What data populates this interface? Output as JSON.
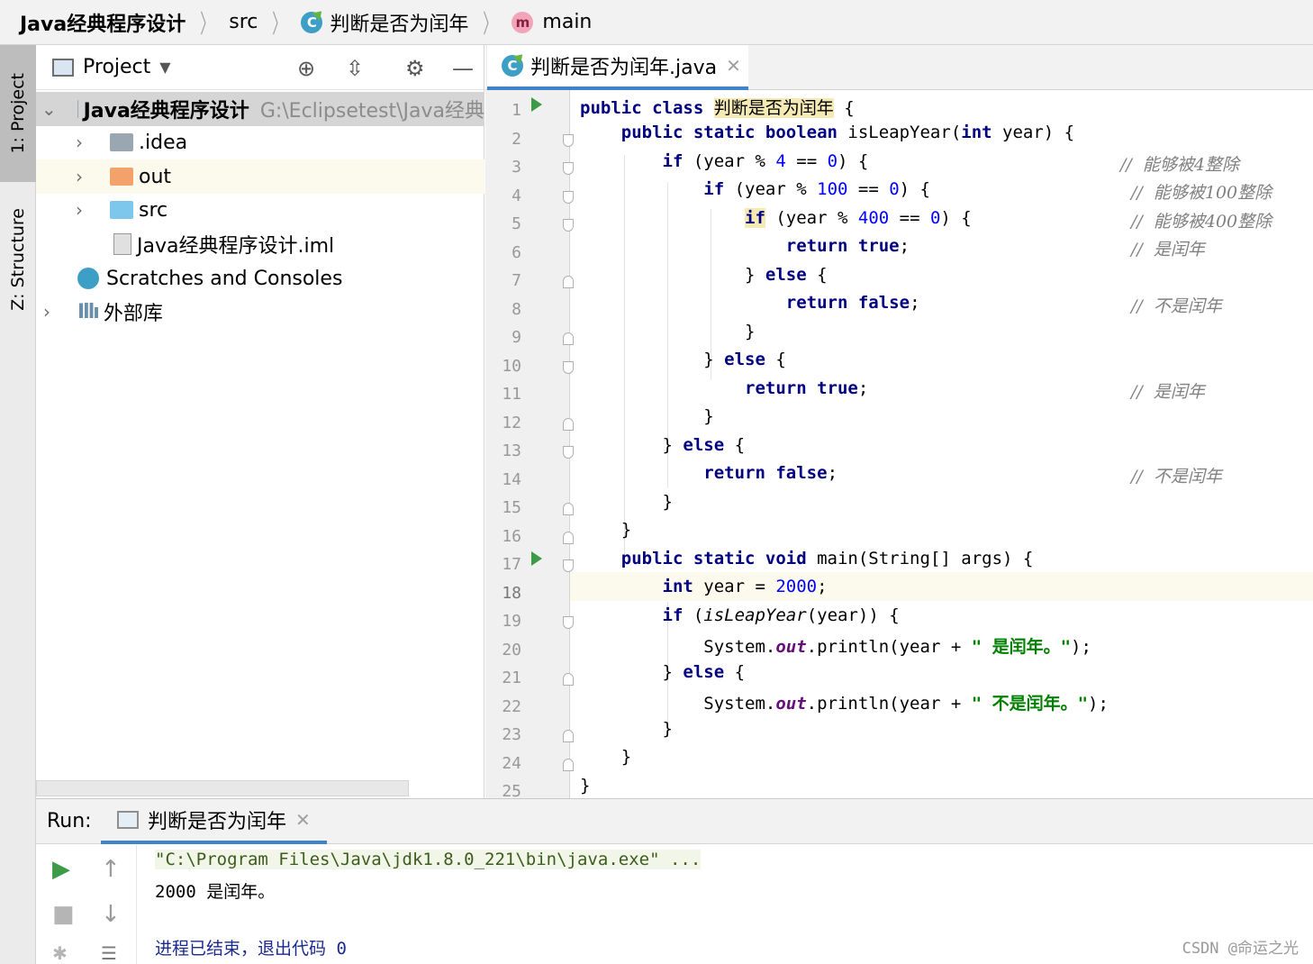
{
  "breadcrumb": {
    "project": "Java经典程序设计",
    "folder": "src",
    "class_icon": "C",
    "class_name": "判断是否为闰年",
    "method_icon": "m",
    "method_name": "main"
  },
  "tool_windows": {
    "project_tab": "1: Project",
    "structure_tab": "Z: Structure"
  },
  "project_panel": {
    "title": "Project",
    "tree": [
      {
        "label": "Java经典程序设计",
        "path": "G:\\Eclipsetest\\Java经典"
      },
      {
        "label": ".idea"
      },
      {
        "label": "out"
      },
      {
        "label": "src"
      },
      {
        "label": "Java经典程序设计.iml"
      },
      {
        "label": "Scratches and Consoles"
      },
      {
        "label": "外部库"
      }
    ]
  },
  "editor": {
    "tab_label": "判断是否为闰年.java",
    "tab_icon": "C",
    "current_line": 18,
    "line_numbers": [
      "1",
      "2",
      "3",
      "4",
      "5",
      "6",
      "7",
      "8",
      "9",
      "10",
      "11",
      "12",
      "13",
      "14",
      "15",
      "16",
      "17",
      "18",
      "19",
      "20",
      "21",
      "22",
      "23",
      "24",
      "25"
    ],
    "comments": {
      "c3": "//  能够被4整除",
      "c4": "//  能够被100整除",
      "c5": "//  能够被400整除",
      "c6": "//  是闰年",
      "c8": "//  不是闰年",
      "c11": "//  是闰年",
      "c14": "//  不是闰年"
    },
    "strings": {
      "s20": "\" 是闰年。\"",
      "s22": "\" 不是闰年。\""
    }
  },
  "run_panel": {
    "label": "Run:",
    "tab_label": "判断是否为闰年",
    "console": {
      "command": "\"C:\\Program Files\\Java\\jdk1.8.0_221\\bin\\java.exe\" ...",
      "output": "2000 是闰年。",
      "exit": "进程已结束，退出代码 0"
    }
  },
  "watermark": "CSDN @命运之光",
  "colors": {
    "keyword": "#000080",
    "number": "#0000ff",
    "string": "#008000",
    "comment": "#808080",
    "run_arrow": "#3d9a47",
    "active_tab_underline": "#4083c9"
  }
}
